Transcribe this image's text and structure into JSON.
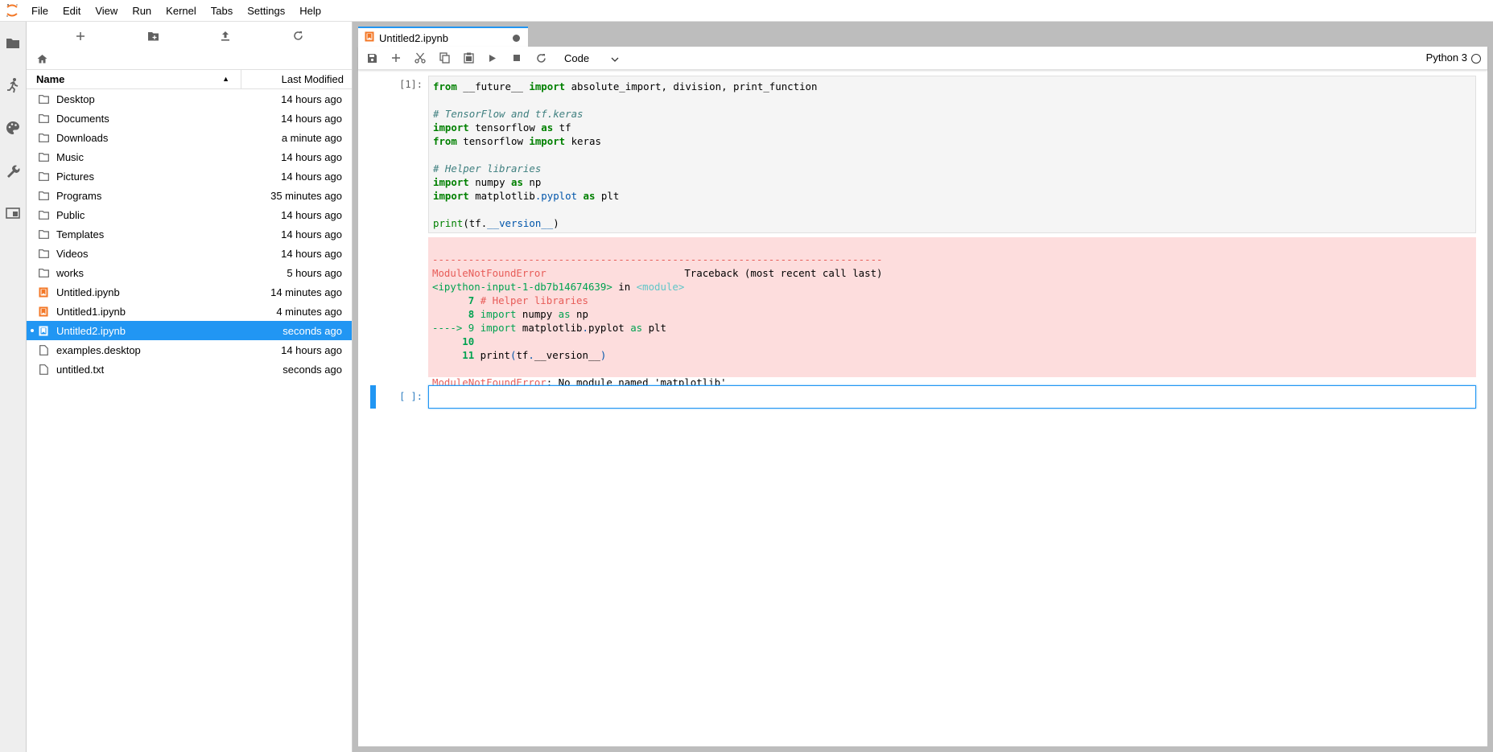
{
  "menubar": {
    "items": [
      "File",
      "Edit",
      "View",
      "Run",
      "Kernel",
      "Tabs",
      "Settings",
      "Help"
    ]
  },
  "activity_icons": [
    "folder-icon",
    "running-icon",
    "palette-icon",
    "wrench-icon",
    "tabs-icon"
  ],
  "filebrowser": {
    "toolbar": [
      "new-launcher-icon",
      "new-folder-icon",
      "upload-icon",
      "refresh-icon"
    ],
    "header": {
      "name": "Name",
      "modified": "Last Modified"
    },
    "files": [
      {
        "name": "Desktop",
        "modified": "14 hours ago",
        "type": "folder"
      },
      {
        "name": "Documents",
        "modified": "14 hours ago",
        "type": "folder"
      },
      {
        "name": "Downloads",
        "modified": "a minute ago",
        "type": "folder"
      },
      {
        "name": "Music",
        "modified": "14 hours ago",
        "type": "folder"
      },
      {
        "name": "Pictures",
        "modified": "14 hours ago",
        "type": "folder"
      },
      {
        "name": "Programs",
        "modified": "35 minutes ago",
        "type": "folder"
      },
      {
        "name": "Public",
        "modified": "14 hours ago",
        "type": "folder"
      },
      {
        "name": "Templates",
        "modified": "14 hours ago",
        "type": "folder"
      },
      {
        "name": "Videos",
        "modified": "14 hours ago",
        "type": "folder"
      },
      {
        "name": "works",
        "modified": "5 hours ago",
        "type": "folder"
      },
      {
        "name": "Untitled.ipynb",
        "modified": "14 minutes ago",
        "type": "notebook"
      },
      {
        "name": "Untitled1.ipynb",
        "modified": "4 minutes ago",
        "type": "notebook"
      },
      {
        "name": "Untitled2.ipynb",
        "modified": "seconds ago",
        "type": "notebook",
        "selected": true
      },
      {
        "name": "examples.desktop",
        "modified": "14 hours ago",
        "type": "file"
      },
      {
        "name": "untitled.txt",
        "modified": "seconds ago",
        "type": "file"
      }
    ]
  },
  "tab": {
    "label": "Untitled2.ipynb"
  },
  "notebook_toolbar": {
    "cell_type": "Code",
    "kernel": "Python 3"
  },
  "cells": [
    {
      "prompt": "[1]:",
      "source_lines": [
        "from __future__ import absolute_import, division, print_function",
        "",
        "# TensorFlow and tf.keras",
        "import tensorflow as tf",
        "from tensorflow import keras",
        "",
        "# Helper libraries",
        "import numpy as np",
        "import matplotlib.pyplot as plt",
        "",
        "print(tf.__version__)"
      ],
      "output": {
        "separator": "---------------------------------------------------------------------------",
        "error_name": "ModuleNotFoundError",
        "traceback_header": "Traceback (most recent call last)",
        "location": "<ipython-input-1-db7b14674639>",
        "in_text": "in",
        "module": "<module>",
        "lines": [
          {
            "marker": "      7",
            "code": "# Helper libraries"
          },
          {
            "marker": "      8",
            "code": "import numpy as np"
          },
          {
            "marker": "----> 9",
            "code": "import matplotlib.pyplot as plt"
          },
          {
            "marker": "     10",
            "code": ""
          },
          {
            "marker": "     11",
            "code": "print(tf.__version__)"
          }
        ],
        "message": "ModuleNotFoundError",
        "message_rest": ": No module named 'matplotlib'"
      }
    },
    {
      "prompt": "[ ]:"
    }
  ]
}
